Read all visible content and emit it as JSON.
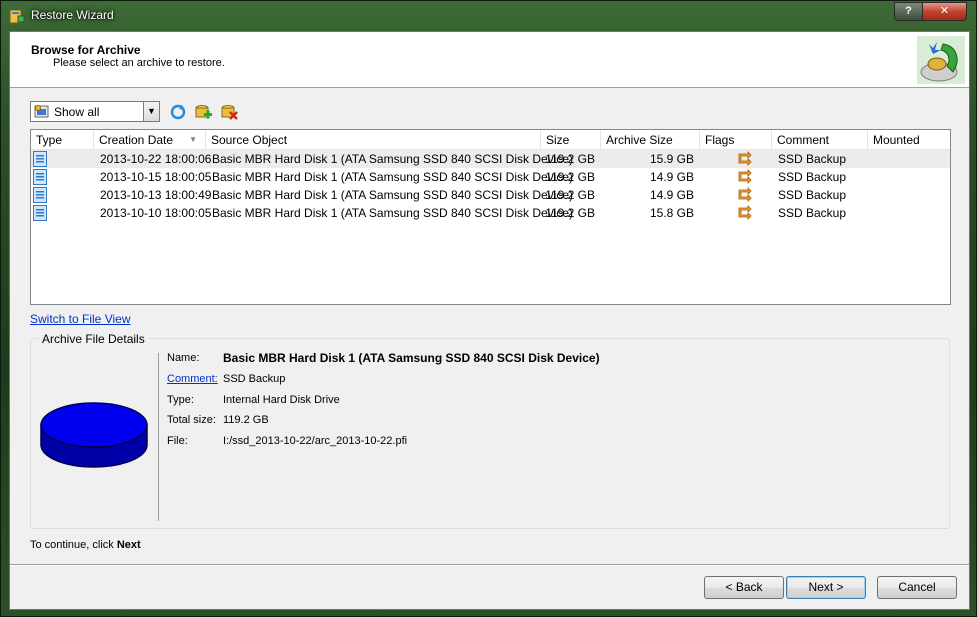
{
  "window": {
    "title": "Restore Wizard",
    "help_label": "?",
    "close_label": "✕"
  },
  "header": {
    "title": "Browse for Archive",
    "subtitle": "Please select an archive to restore."
  },
  "toolbar": {
    "filter_value": "Show all"
  },
  "list": {
    "columns": [
      "Type",
      "Creation Date",
      "Source Object",
      "Size",
      "Archive Size",
      "Flags",
      "Comment",
      "Mounted"
    ],
    "rows": [
      {
        "date": "2013-10-22 18:00:06",
        "source": "Basic MBR Hard Disk 1 (ATA Samsung SSD 840 SCSI Disk Device)",
        "size": "119.2 GB",
        "archive_size": "15.9 GB",
        "comment": "SSD Backup",
        "selected": true
      },
      {
        "date": "2013-10-15 18:00:05",
        "source": "Basic MBR Hard Disk 1 (ATA Samsung SSD 840 SCSI Disk Device)",
        "size": "119.2 GB",
        "archive_size": "14.9 GB",
        "comment": "SSD Backup",
        "selected": false
      },
      {
        "date": "2013-10-13 18:00:49",
        "source": "Basic MBR Hard Disk 1 (ATA Samsung SSD 840 SCSI Disk Device)",
        "size": "119.2 GB",
        "archive_size": "14.9 GB",
        "comment": "SSD Backup",
        "selected": false
      },
      {
        "date": "2013-10-10 18:00:05",
        "source": "Basic MBR Hard Disk 1 (ATA Samsung SSD 840 SCSI Disk Device)",
        "size": "119.2 GB",
        "archive_size": "15.8 GB",
        "comment": "SSD Backup",
        "selected": false
      }
    ]
  },
  "switch_link": "Switch to File View",
  "details": {
    "group_title": "Archive File Details",
    "name_label": "Name:",
    "name_value": "Basic MBR Hard Disk 1 (ATA Samsung SSD 840 SCSI Disk Device)",
    "comment_label": "Comment:",
    "comment_value": "SSD Backup",
    "type_label": "Type:",
    "type_value": "Internal Hard Disk Drive",
    "size_label": "Total size:",
    "size_value": "119.2 GB",
    "file_label": "File:",
    "file_value": "I:/ssd_2013-10-22/arc_2013-10-22.pfi"
  },
  "footer": {
    "continue_prefix": "To continue, click",
    "continue_bold": "Next"
  },
  "buttons": {
    "back": "< Back",
    "next": "Next >",
    "cancel": "Cancel"
  }
}
